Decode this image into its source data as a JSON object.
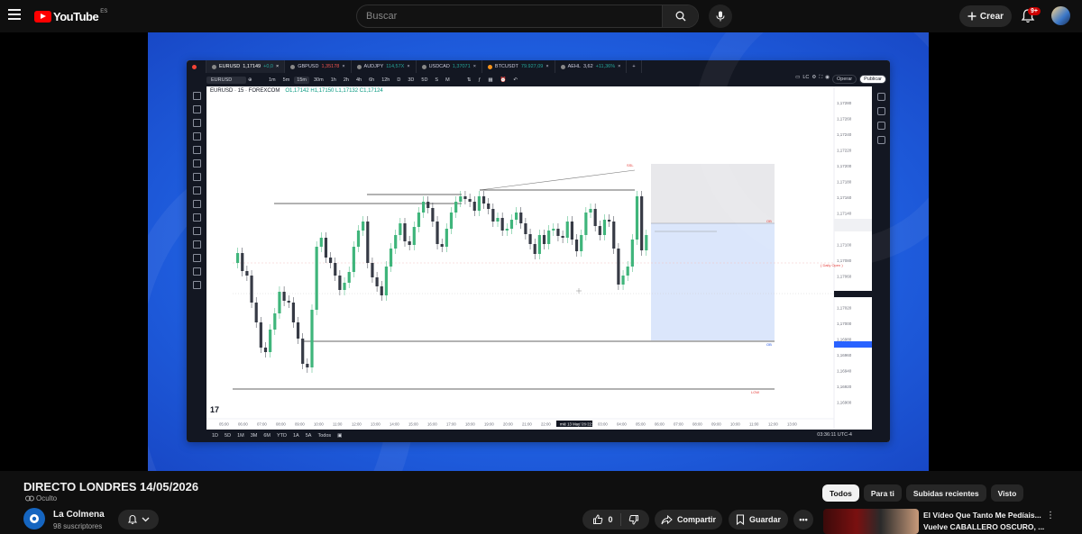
{
  "header": {
    "brand": "YouTube",
    "country_code": "ES",
    "search_placeholder": "Buscar",
    "create_label": "Crear",
    "notifications_badge": "9+"
  },
  "tradingview": {
    "tabs": [
      {
        "symbol": "EURUSD",
        "price": "1,17149",
        "change": "+0,0"
      },
      {
        "symbol": "GBPUSD",
        "price": "1,35178",
        "change": ""
      },
      {
        "symbol": "AUDJPY",
        "price": "114,57X",
        "change": ""
      },
      {
        "symbol": "USDCAD",
        "price": "1,37071",
        "change": ""
      },
      {
        "symbol": "BTCUSDT",
        "price": "79.927,09",
        "change": ""
      },
      {
        "symbol": "AEHL",
        "price": "3,62",
        "change": "+11,36%"
      }
    ],
    "symbol_box": "EURUSD",
    "timeframes": [
      "1m",
      "5m",
      "15m",
      "30m",
      "1h",
      "2h",
      "4h",
      "6h",
      "12h",
      "D",
      "3D",
      "5D",
      "S",
      "M"
    ],
    "active_timeframe": "15m",
    "buttons": {
      "lc": "LC",
      "operar": "Operar",
      "publicar": "Publicar"
    },
    "legend": {
      "symbol": "EURUSD · 15 · FOREXCOM",
      "ohlc": "O1,17142 H1,17150 L1,17132 C1,17124"
    },
    "bottom_ranges": [
      "1D",
      "5D",
      "1M",
      "3M",
      "6M",
      "YTD",
      "1A",
      "5A",
      "Todos"
    ],
    "clock": "03:36:11 UTC-4",
    "chart_labels": {
      "ssl": "SSL",
      "daily_open": "( Daily Open )",
      "ob": "OB",
      "low": "LOW"
    },
    "price_axis": [
      "1,17280",
      "1,17260",
      "1,17240",
      "1,17220",
      "1,17200",
      "1,17180",
      "1,17160",
      "1,17140",
      "1,17120",
      "1,17100",
      "1,17080",
      "1,17060",
      "1,17040",
      "1,17020",
      "1,17000",
      "1,16980",
      "1,16960",
      "1,16940",
      "1,16920",
      "1,16900"
    ],
    "time_axis": [
      "05:00",
      "06:00",
      "07:00",
      "08:00",
      "09:00",
      "10:00",
      "11:00",
      "12:00",
      "13:00",
      "14:00",
      "15:00",
      "16:00",
      "17:00",
      "18:00",
      "19:00",
      "20:00",
      "21:00",
      "22:00",
      "mié 13 May '26 22:45",
      "02:00",
      "03:00",
      "04:00",
      "05:00",
      "06:00",
      "07:00",
      "08:00",
      "09:00",
      "10:00",
      "11:00",
      "12:00",
      "13:00"
    ]
  },
  "video": {
    "title": "DIRECTO LONDRES 14/05/2026",
    "privacy": "Oculto"
  },
  "channel": {
    "name": "La Colmena",
    "subscribers": "98 suscriptores"
  },
  "actions": {
    "likes": "0",
    "share": "Compartir",
    "save": "Guardar"
  },
  "chips": [
    "Todos",
    "Para ti",
    "Subidas recientes",
    "Visto"
  ],
  "recommended": {
    "title_line1": "El Vídeo Que Tanto Me Pedíais...",
    "title_line2": "Vuelve CABALLERO OSCURO, ..."
  }
}
